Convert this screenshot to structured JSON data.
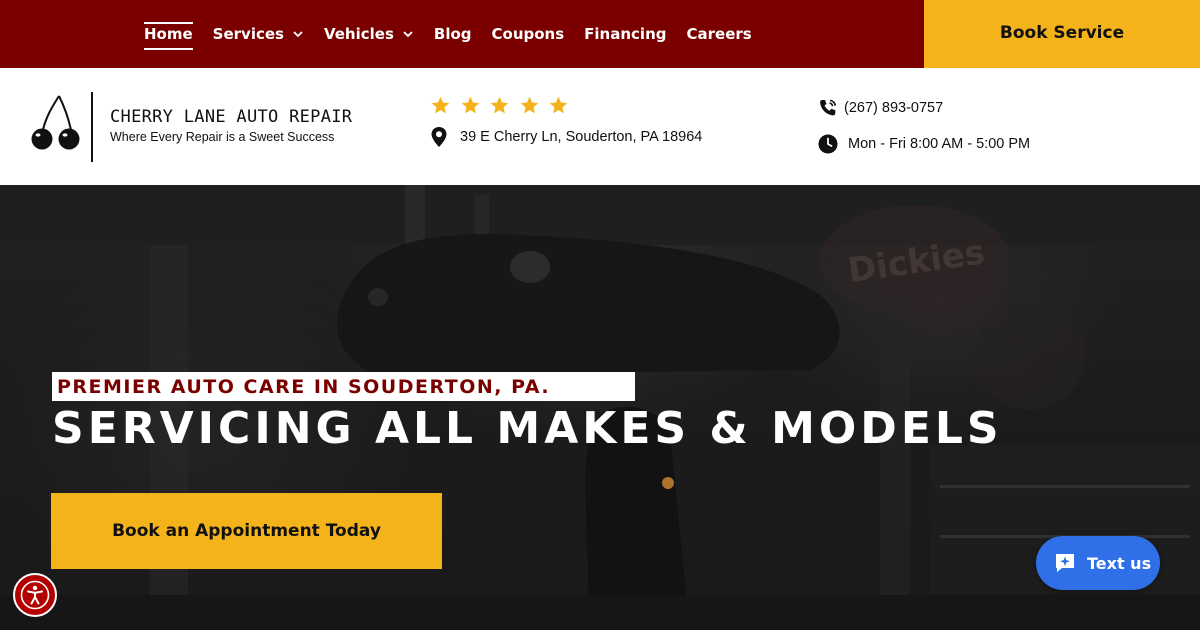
{
  "nav": {
    "items": [
      {
        "label": "Home",
        "active": true,
        "dropdown": false
      },
      {
        "label": "Services",
        "active": false,
        "dropdown": true
      },
      {
        "label": "Vehicles",
        "active": false,
        "dropdown": true
      },
      {
        "label": "Blog",
        "active": false,
        "dropdown": false
      },
      {
        "label": "Coupons",
        "active": false,
        "dropdown": false
      },
      {
        "label": "Financing",
        "active": false,
        "dropdown": false
      },
      {
        "label": "Careers",
        "active": false,
        "dropdown": false
      }
    ],
    "book_service": "Book Service"
  },
  "header": {
    "logo_name": "CHERRY LANE AUTO REPAIR",
    "logo_tagline": "Where Every Repair is a Sweet Success",
    "rating_stars": 5,
    "address": "39 E Cherry Ln, Souderton, PA 18964",
    "phone": "(267) 893-0757",
    "hours": "Mon - Fri 8:00 AM - 5:00 PM"
  },
  "hero": {
    "eyebrow": "PREMIER AUTO CARE IN SOUDERTON, PA.",
    "headline": "SERVICING ALL MAKES & MODELS",
    "cta": "Book an Appointment Today"
  },
  "widgets": {
    "textus_label": "Text us"
  },
  "colors": {
    "brand_red": "#7a0000",
    "accent_yellow": "#f4b31b",
    "chat_blue": "#2f6fe8"
  }
}
